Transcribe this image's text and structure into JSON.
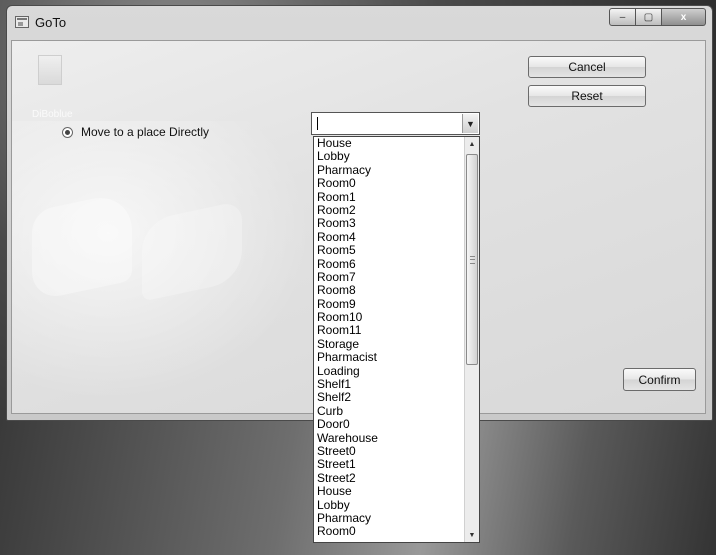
{
  "window": {
    "title": "GoTo"
  },
  "caption": {
    "minimize": "–",
    "maximize": "▢",
    "close": "x"
  },
  "background": {
    "ghost_label": "DiBoblue"
  },
  "radio": {
    "label": "Move to a place Directly",
    "checked": true
  },
  "buttons": {
    "cancel": "Cancel",
    "reset": "Reset",
    "confirm": "Confirm"
  },
  "combo": {
    "value": "",
    "arrow": "▼"
  },
  "dropdown": {
    "items": [
      "House",
      "Lobby",
      "Pharmacy",
      "Room0",
      "Room1",
      "Room2",
      "Room3",
      "Room4",
      "Room5",
      "Room6",
      "Room7",
      "Room8",
      "Room9",
      "Room10",
      "Room11",
      "Storage",
      "Pharmacist",
      "Loading",
      "Shelf1",
      "Shelf2",
      "Curb",
      "Door0",
      "Warehouse",
      "Street0",
      "Street1",
      "Street2",
      "House",
      "Lobby",
      "Pharmacy",
      "Room0"
    ],
    "scroll_up": "▲",
    "scroll_down": "▼"
  }
}
